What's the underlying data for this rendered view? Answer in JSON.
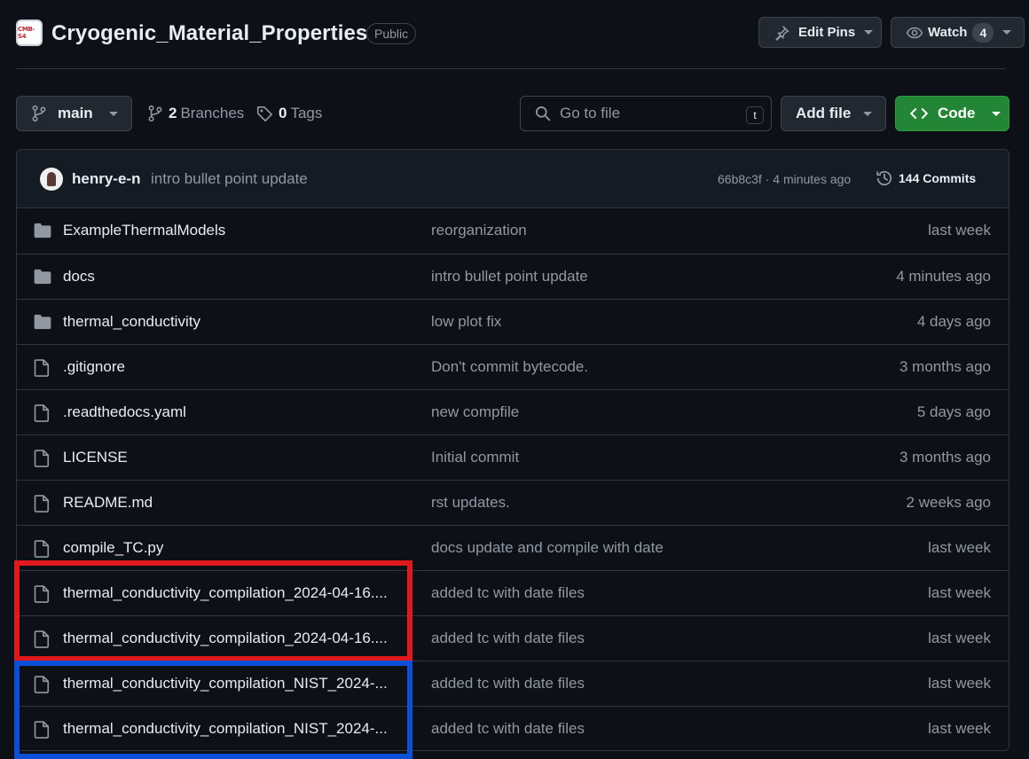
{
  "repo": {
    "logo_text": "CMB-S4",
    "name": "Cryogenic_Material_Properties",
    "visibility": "Public"
  },
  "actions": {
    "edit_pins_label": "Edit Pins",
    "watch_label": "Watch",
    "watch_count": "4"
  },
  "toolbar": {
    "branch": "main",
    "branches_count": "2",
    "branches_label": "Branches",
    "tags_count": "0",
    "tags_label": "Tags",
    "search_placeholder": "Go to file",
    "search_shortcut": "t",
    "add_file_label": "Add file",
    "code_label": "Code"
  },
  "latest_commit": {
    "author": "henry-e-n",
    "message": "intro bullet point update",
    "hash_time": "66b8c3f · 4 minutes ago",
    "commits_label": "144 Commits"
  },
  "files": [
    {
      "type": "folder",
      "name": "ExampleThermalModels",
      "message": "reorganization",
      "date": "last week"
    },
    {
      "type": "folder",
      "name": "docs",
      "message": "intro bullet point update",
      "date": "4 minutes ago"
    },
    {
      "type": "folder",
      "name": "thermal_conductivity",
      "message": "low plot fix",
      "date": "4 days ago"
    },
    {
      "type": "file",
      "name": ".gitignore",
      "message": "Don't commit bytecode.",
      "date": "3 months ago"
    },
    {
      "type": "file",
      "name": ".readthedocs.yaml",
      "message": "new compfile",
      "date": "5 days ago"
    },
    {
      "type": "file",
      "name": "LICENSE",
      "message": "Initial commit",
      "date": "3 months ago"
    },
    {
      "type": "file",
      "name": "README.md",
      "message": "rst updates.",
      "date": "2 weeks ago"
    },
    {
      "type": "file",
      "name": "compile_TC.py",
      "message": "docs update and compile with date",
      "date": "last week"
    },
    {
      "type": "file",
      "name": "thermal_conductivity_compilation_2024-04-16....",
      "message": "added tc with date files",
      "date": "last week"
    },
    {
      "type": "file",
      "name": "thermal_conductivity_compilation_2024-04-16....",
      "message": "added tc with date files",
      "date": "last week"
    },
    {
      "type": "file",
      "name": "thermal_conductivity_compilation_NIST_2024-...",
      "message": "added tc with date files",
      "date": "last week"
    },
    {
      "type": "file",
      "name": "thermal_conductivity_compilation_NIST_2024-...",
      "message": "added tc with date files",
      "date": "last week"
    }
  ],
  "highlights": {
    "red": "#e0191c",
    "blue": "#0a4fd6"
  }
}
